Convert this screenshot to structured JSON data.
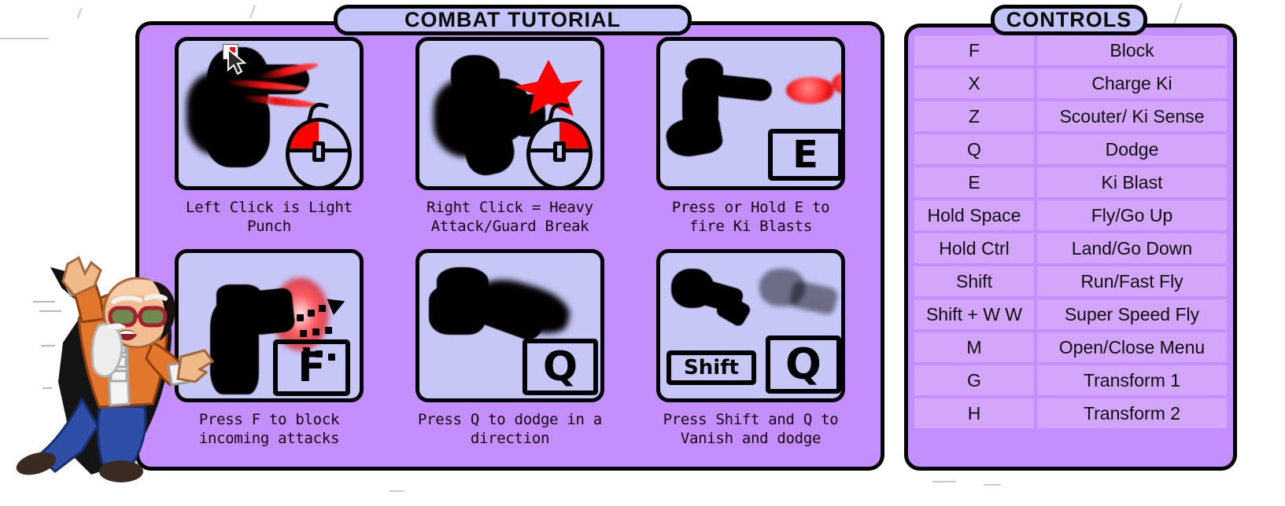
{
  "tutorial": {
    "title": "COMBAT TUTORIAL",
    "cards": [
      {
        "id": "light-punch",
        "caption": "Left Click is Light Punch",
        "key_hint": "",
        "icon": "mouse-left-click-icon",
        "highlight_color": "#ff0000"
      },
      {
        "id": "heavy-attack",
        "caption": "Right Click = Heavy Attack/Guard Break",
        "key_hint": "",
        "icon": "mouse-right-click-icon",
        "highlight_color": "#ff0000"
      },
      {
        "id": "ki-blast",
        "caption": "Press or Hold E to fire Ki Blasts",
        "key_hint": "E",
        "icon": "ki-blast-icon",
        "highlight_color": "#ff3a3a"
      },
      {
        "id": "block",
        "caption": "Press F to block incoming attacks",
        "key_hint": "F",
        "icon": "block-aura-icon",
        "highlight_color": "#ff5050"
      },
      {
        "id": "dodge",
        "caption": "Press Q to dodge in a direction",
        "key_hint": "Q",
        "icon": "dodge-icon",
        "highlight_color": "#000000"
      },
      {
        "id": "vanish",
        "caption": "Press Shift and Q to Vanish and dodge",
        "key_hint": "Q",
        "key_hint_modifier": "Shift",
        "icon": "vanish-icon",
        "highlight_color": "#000000"
      }
    ]
  },
  "controls": {
    "title": "CONTROLS",
    "rows": [
      {
        "key": "F",
        "action": "Block"
      },
      {
        "key": "X",
        "action": "Charge Ki"
      },
      {
        "key": "Z",
        "action": "Scouter/ Ki Sense"
      },
      {
        "key": "Q",
        "action": "Dodge"
      },
      {
        "key": "E",
        "action": "Ki Blast"
      },
      {
        "key": "Hold Space",
        "action": "Fly/Go Up"
      },
      {
        "key": "Hold Ctrl",
        "action": "Land/Go Down"
      },
      {
        "key": "Shift",
        "action": "Run/Fast Fly"
      },
      {
        "key": "Shift + W W",
        "action": "Super Speed Fly"
      },
      {
        "key": "M",
        "action": "Open/Close Menu"
      },
      {
        "key": "G",
        "action": "Transform 1"
      },
      {
        "key": "H",
        "action": "Transform 2"
      }
    ]
  },
  "character": {
    "name": "master-roshi-character"
  },
  "colors": {
    "panel": "#c48ffc",
    "card": "#c6c6f7",
    "tab": "#c3c3f8",
    "table_cell": "#d4a6fb",
    "outline": "#000000",
    "accent_red": "#ff0000"
  }
}
